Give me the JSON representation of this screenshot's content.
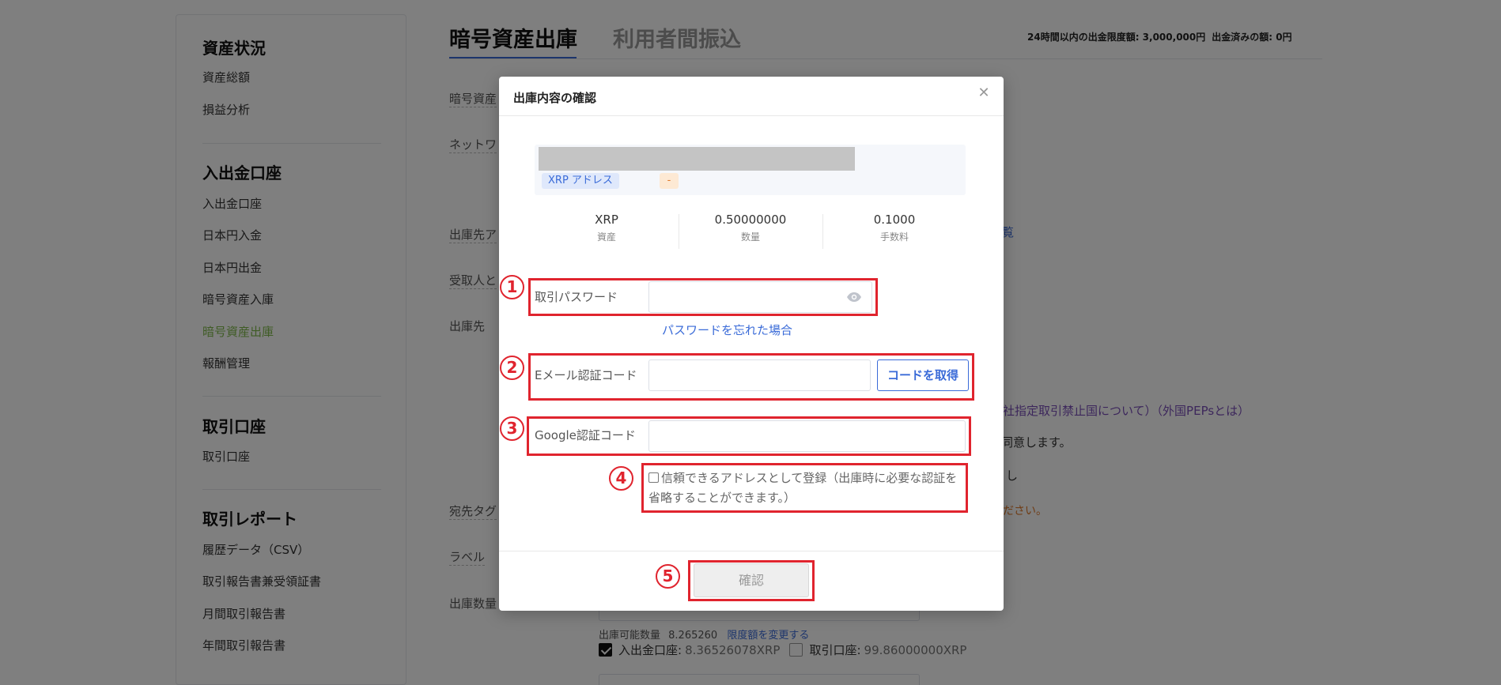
{
  "sidebar": {
    "sections": [
      {
        "title": "資産状況",
        "items": [
          "資産総額",
          "損益分析"
        ]
      },
      {
        "title": "入出金口座",
        "items": [
          "入出金口座",
          "日本円入金",
          "日本円出金",
          "暗号資産入庫",
          "暗号資産出庫",
          "報酬管理"
        ]
      },
      {
        "title": "取引口座",
        "items": [
          "取引口座"
        ]
      },
      {
        "title": "取引レポート",
        "items": [
          "履歴データ（CSV）",
          "取引報告書兼受領証書",
          "月間取引報告書",
          "年間取引報告書"
        ]
      }
    ],
    "active_item": "暗号資産出庫"
  },
  "tabs": {
    "active": "暗号資産出庫",
    "inactive": "利用者間振込"
  },
  "limits": {
    "daily_limit": "24時間以内の出金限度額: 3,000,000円",
    "withdrawn": "出金済みの額: 0円"
  },
  "background_form": {
    "label_asset": "暗号資産",
    "label_network": "ネットワ",
    "label_dest_address": "出庫先ア",
    "link_list_fragment": "覧",
    "label_recipient": "受取人と",
    "label_destination": "出庫先",
    "restricted_link": "社指定取引禁止国について）（外国PEPsとは）",
    "agree_text": "同意します。",
    "fragment_shi": "し",
    "label_dest_tag": "宛先タグ",
    "dest_tag_warning": "ださい。",
    "label_label": "ラベル",
    "label_amount": "出庫数量",
    "available_label": "出庫可能数量",
    "available_value": "8.265260",
    "change_limit_link": "限度額を変更する",
    "deposit_account_label": "入出金口座:",
    "deposit_account_value": "8.36526078XRP",
    "trading_account_label": "取引口座:",
    "trading_account_value": "99.86000000XRP"
  },
  "modal": {
    "title": "出庫内容の確認",
    "address_tag": "XRP アドレス",
    "address_dash": "-",
    "stats": [
      {
        "value": "XRP",
        "label": "資産"
      },
      {
        "value": "0.50000000",
        "label": "数量"
      },
      {
        "value": "0.1000",
        "label": "手数料"
      }
    ],
    "password_label": "取引パスワード",
    "forgot_password": "パスワードを忘れた場合",
    "email_label": "Eメール認証コード",
    "get_code": "コードを取得",
    "google_label": "Google認証コード",
    "trust_text": "信頼できるアドレスとして登録（出庫時に必要な認証を省略することができます。）",
    "confirm": "確認"
  },
  "annotations": [
    "1",
    "2",
    "3",
    "4",
    "5"
  ],
  "colors": {
    "accent_blue": "#3a6bd8",
    "active_green": "#7fb84a",
    "annotation_red": "#e0242e",
    "overlay": "rgba(0,0,0,0.5)"
  }
}
